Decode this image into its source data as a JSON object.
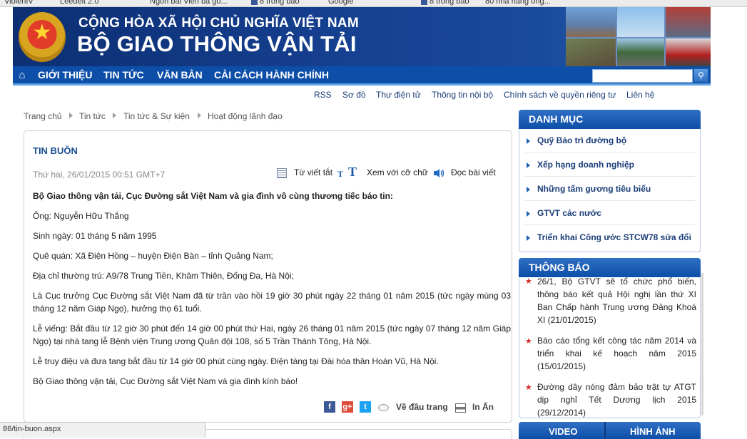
{
  "browser": {
    "bookmarks": [
      "ViolenIV",
      "Leedelt 2.0",
      "Ngon bai Vien ba go...",
      "8 trong bao",
      "Google",
      "8 trong bao",
      "80 nha hang ong..."
    ],
    "status_url": "86/tin-buon.aspx"
  },
  "header": {
    "line1": "CỘNG HÒA XÃ HỘI CHỦ NGHĨA VIỆT NAM",
    "line2": "BỘ GIAO THÔNG VẬN TẢI"
  },
  "nav": {
    "items": [
      "GIỚI THIỆU",
      "TIN TỨC",
      "VĂN BẢN",
      "CẢI CÁCH HÀNH CHÍNH"
    ]
  },
  "subnav": {
    "items": [
      "RSS",
      "Sơ đồ",
      "Thư điện tử",
      "Thông tin nội bộ",
      "Chính sách về quyền riêng tư",
      "Liên hệ"
    ]
  },
  "breadcrumb": [
    "Trang chủ",
    "Tin tức",
    "Tin tức & Sự kiện",
    "Hoạt động lãnh đạo"
  ],
  "article": {
    "title": "TIN BUỒN",
    "date": "Thứ hai, 26/01/2015 00:51 GMT+7",
    "tools": {
      "glossary": "Từ viết tắt",
      "font_small": "T",
      "font_big": "T",
      "font_size": "Xem với cỡ chữ",
      "read": "Đọc bài viết"
    },
    "paragraphs": [
      "Bộ Giao thông vận tải, Cục Đường sắt Việt Nam và gia đình vô cùng thương tiếc báo tin:",
      "Ông: Nguyễn Hữu Thắng",
      "Sinh ngày: 01 tháng 5 năm 1995",
      "Quê quán: Xã Điện Hồng – huyện Điện Bàn – tỉnh Quảng Nam;",
      "Địa chỉ thường trú: A9/78 Trung Tiền, Khâm Thiên, Đống Đa, Hà Nội;",
      "Là Cục trưởng Cục Đường sắt Việt Nam đã từ trần vào hồi 19 giờ 30 phút ngày 22 tháng 01 năm 2015 (tức ngày mùng 03 tháng 12 năm Giáp Ngọ), hưởng thọ 61 tuổi.",
      "Lễ viếng: Bắt đầu từ 12 giờ 30 phút đến 14 giờ 00 phút thứ Hai, ngày 26 tháng 01 năm 2015 (tức ngày 07 tháng 12 năm Giáp Ngọ) tại nhà tang lễ Bệnh viện Trung ương Quân đội 108, số 5 Trần Thánh Tông, Hà Nội.",
      "Lễ truy điệu và đưa tang bắt đầu từ 14 giờ 00 phút cùng ngày. Điện táng tại Đài hóa thân Hoàn Vũ, Hà Nội.",
      "Bộ Giao thông vận tải, Cục Đường sắt Việt Nam và gia đình kính báo!"
    ],
    "footer": {
      "top": "Về đầu trang",
      "print": "In Ấn"
    }
  },
  "sidebar": {
    "categories_title": "DANH MỤC",
    "categories": [
      "Quỹ Bảo trì đường bộ",
      "Xếp hạng doanh nghiệp",
      "Những tấm gương tiêu biểu",
      "GTVT các nước",
      "Triển khai Công ước STCW78 sửa đổi"
    ],
    "notices_title": "THÔNG BÁO",
    "notices": [
      "26/1, Bộ GTVT sẽ tổ chức phổ biến, thông báo kết quả Hội nghị lần thứ XI Ban Chấp hành Trung ương Đảng Khoá XI  (21/01/2015)",
      "Báo cáo tổng kết công tác năm 2014 và triển khai kế hoạch năm 2015  (15/01/2015)",
      "Đường dây nóng đảm bảo trật tự ATGT dịp nghỉ Tết Dương lịch 2015  (29/12/2014)"
    ],
    "tabs": [
      "VIDEO",
      "HÌNH ẢNH"
    ]
  },
  "colors": {
    "brand_dark": "#0d2f73",
    "nav": "#0d4fa8",
    "link": "#1a3d78",
    "star": "#d42a2a"
  }
}
